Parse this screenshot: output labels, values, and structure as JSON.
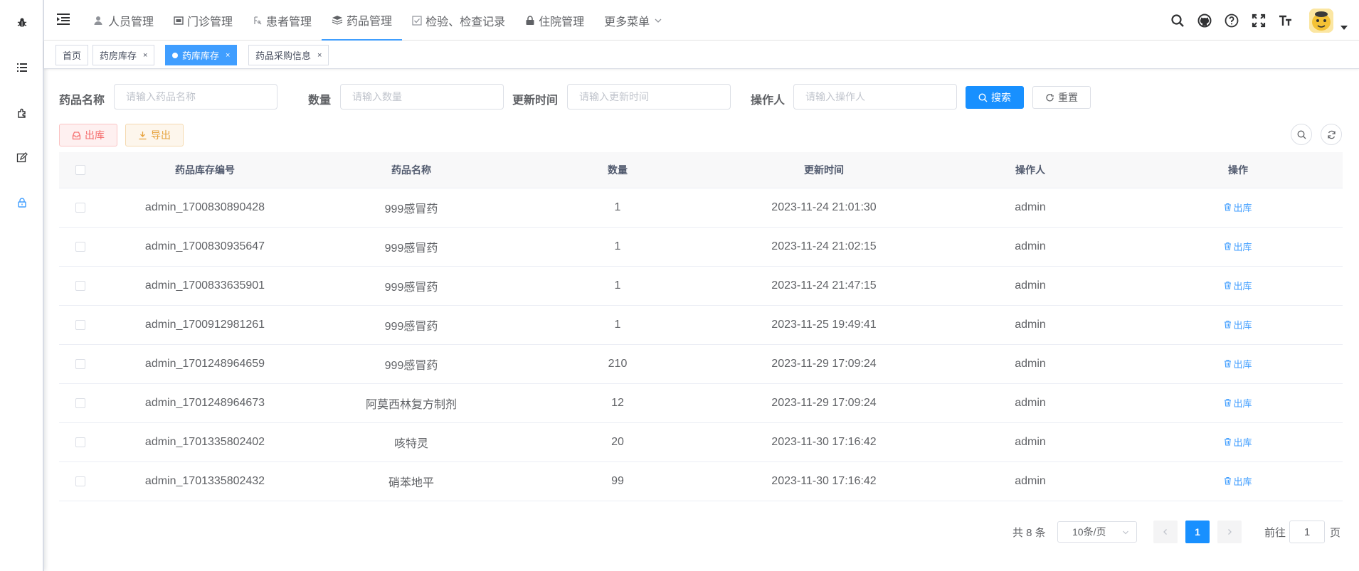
{
  "nav": {
    "menu": [
      {
        "label": "人员管理",
        "icon": "user-icon"
      },
      {
        "label": "门诊管理",
        "icon": "clinic-icon"
      },
      {
        "label": "患者管理",
        "icon": "patient-icon"
      },
      {
        "label": "药品管理",
        "icon": "medicine-icon"
      },
      {
        "label": "检验、检查记录",
        "icon": "check-icon"
      },
      {
        "label": "住院管理",
        "icon": "lock-icon"
      },
      {
        "label": "更多菜单",
        "icon": "chevron-down-icon"
      }
    ],
    "active_menu": "药品管理"
  },
  "tags": [
    {
      "label": "首页"
    },
    {
      "label": "药房库存",
      "close": "×"
    },
    {
      "label": "药库库存",
      "close": "×"
    },
    {
      "label": "药品采购信息",
      "close": "×"
    }
  ],
  "search": {
    "name_label": "药品名称",
    "name_placeholder": "请输入药品名称",
    "qty_label": "数量",
    "qty_placeholder": "请输入数量",
    "time_label": "更新时间",
    "time_placeholder": "请输入更新时间",
    "op_label": "操作人",
    "op_placeholder": "请输入操作人",
    "search_btn": "搜索",
    "reset_btn": "重置"
  },
  "toolbar": {
    "outbound_btn": "出库",
    "export_btn": "导出"
  },
  "table": {
    "headers": [
      "药品库存编号",
      "药品名称",
      "数量",
      "更新时间",
      "操作人",
      "操作"
    ],
    "action_label": "出库",
    "rows": [
      [
        "admin_1700830890428",
        "999感冒药",
        "1",
        "2023-11-24 21:01:30",
        "admin"
      ],
      [
        "admin_1700830935647",
        "999感冒药",
        "1",
        "2023-11-24 21:02:15",
        "admin"
      ],
      [
        "admin_1700833635901",
        "999感冒药",
        "1",
        "2023-11-24 21:47:15",
        "admin"
      ],
      [
        "admin_1700912981261",
        "999感冒药",
        "1",
        "2023-11-25 19:49:41",
        "admin"
      ],
      [
        "admin_1701248964659",
        "999感冒药",
        "210",
        "2023-11-29 17:09:24",
        "admin"
      ],
      [
        "admin_1701248964673",
        "阿莫西林复方制剂",
        "12",
        "2023-11-29 17:09:24",
        "admin"
      ],
      [
        "admin_1701335802402",
        "咳特灵",
        "20",
        "2023-11-30 17:16:42",
        "admin"
      ],
      [
        "admin_1701335802432",
        "硝苯地平",
        "99",
        "2023-11-30 17:16:42",
        "admin"
      ]
    ]
  },
  "pagination": {
    "total": "共 8 条",
    "page_size": "10条/页",
    "current_page": "1",
    "goto_label": "前往",
    "goto_value": "1",
    "page_suffix": "页"
  },
  "colors": {
    "primary": "#1890ff",
    "danger": "#f56c6c",
    "warning": "#e6a23c"
  }
}
